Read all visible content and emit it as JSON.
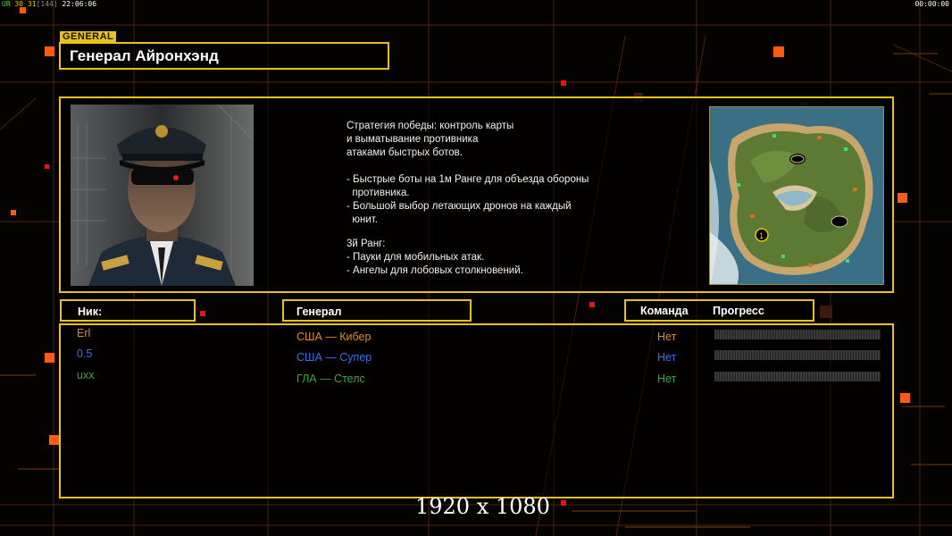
{
  "hud": {
    "left_prefix": "UR",
    "left_nums": "30 31",
    "left_bracket": "[144]",
    "left_time": "22:06:06",
    "right_time": "00:00:00"
  },
  "general": {
    "tag": "GENERAL",
    "name": "Генерал Айронхэнд"
  },
  "description": {
    "lines": [
      "Стратегия победы: контроль карты",
      "и выматывание противника",
      "атаками быстрых ботов.",
      "",
      "- Быстрые боты на 1м Ранге для объезда обороны",
      "  противника.",
      "- Большой выбор летающих дронов на каждый",
      "  юнит.",
      "",
      "3й Ранг:",
      "- Пауки для мобильных атак.",
      "- Ангелы для лобовых столкновений."
    ]
  },
  "table": {
    "headers": {
      "nick": "Ник:",
      "general": "Генерал",
      "team": "Команда",
      "progress": "Прогресс"
    },
    "rows": [
      {
        "nick": "Erl",
        "general": "США — Кибер",
        "team": "Нет",
        "progress": 0,
        "color": "#e08a2a"
      },
      {
        "nick": "0.5",
        "general": "США — Супер",
        "team": "Нет",
        "progress": 0,
        "color": "#3a6ef0"
      },
      {
        "nick": "uxx",
        "general": "ГЛА — Стелс",
        "team": "Нет",
        "progress": 0,
        "color": "#3aa83a"
      }
    ]
  },
  "resolution_label": "1920 x 1080",
  "colors": {
    "frame": "#e6c21a",
    "accent_orange": "#ff5a14",
    "grid": "#5a2a10"
  },
  "icons": [
    "general-portrait-image",
    "minimap-image",
    "decor-orange-square-icon"
  ]
}
